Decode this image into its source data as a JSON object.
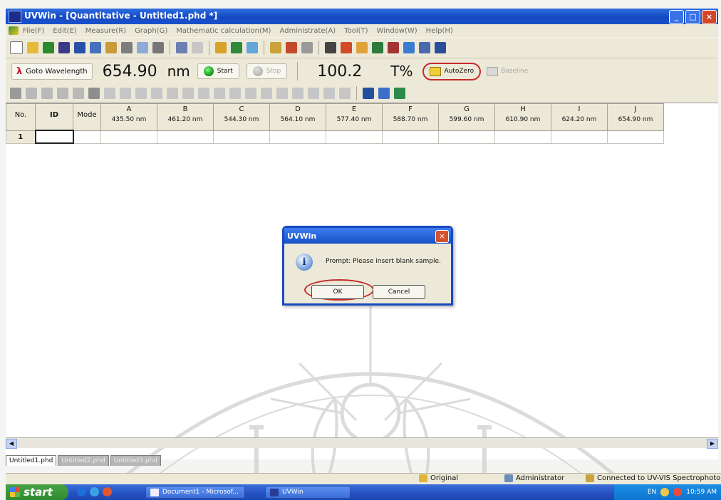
{
  "window": {
    "title": "UVWin - [Quantitative - Untitled1.phd *]",
    "buttons": {
      "minimize": "_",
      "maximize": "□",
      "close": "×"
    }
  },
  "menu": [
    "File(F)",
    "Edit(E)",
    "Measure(R)",
    "Graph(G)",
    "Mathematic calculation(M)",
    "Administrate(A)",
    "Tool(T)",
    "Window(W)",
    "Help(H)"
  ],
  "instrument": {
    "goto_label": "Goto Wavelength",
    "wavelength": "654.90",
    "wavelength_unit": "nm",
    "start_label": "Start",
    "stop_label": "Stop",
    "reading": "100.2",
    "reading_unit": "T%",
    "autozero_label": "AutoZero",
    "baseline_label": "Baseline"
  },
  "grid": {
    "headers": {
      "no": "No.",
      "id": "ID",
      "mode": "Mode"
    },
    "columns": [
      {
        "letter": "A",
        "wavelength": "435.50 nm"
      },
      {
        "letter": "B",
        "wavelength": "461.20 nm"
      },
      {
        "letter": "C",
        "wavelength": "544.30 nm"
      },
      {
        "letter": "D",
        "wavelength": "564.10 nm"
      },
      {
        "letter": "E",
        "wavelength": "577.40 nm"
      },
      {
        "letter": "F",
        "wavelength": "588.70 nm"
      },
      {
        "letter": "G",
        "wavelength": "599.60 nm"
      },
      {
        "letter": "H",
        "wavelength": "610.90 nm"
      },
      {
        "letter": "I",
        "wavelength": "624.20 nm"
      },
      {
        "letter": "J",
        "wavelength": "654.90 nm"
      }
    ],
    "rows": [
      {
        "no": "1"
      }
    ]
  },
  "dialog": {
    "title": "UVWin",
    "message": "Prompt: Please insert blank sample.",
    "ok_label": "OK",
    "cancel_label": "Cancel"
  },
  "tabs": [
    {
      "label": "Untitled1.phd",
      "active": true
    },
    {
      "label": "Untitled2.phd",
      "active": false
    },
    {
      "label": "Untitled3.phd",
      "active": false
    }
  ],
  "status": {
    "original": "Original",
    "user": "Administrator",
    "connection": "Connected to UV-VIS Spectrophoto"
  },
  "taskbar": {
    "start_label": "start",
    "task1": "Document1 - Microsof...",
    "task2": "UVWin",
    "lang": "EN",
    "clock": "10:59 AM"
  }
}
